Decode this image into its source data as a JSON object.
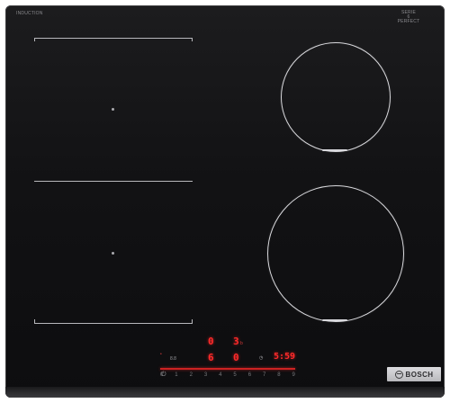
{
  "labels": {
    "induction": "INDUCTION",
    "serie_line1": "SERIE",
    "serie_line2": "6",
    "serie_line3": "PERFECT"
  },
  "display": {
    "zone_front_left_power": "0",
    "zone_front_left_setting": "6",
    "zone_rear_right_power": "3",
    "zone_rear_right_suffix": "b",
    "zone_front_right_setting": "0",
    "timer_value": "5:59",
    "timer_prefix": "8.8",
    "slider_digits": [
      "0",
      "1",
      "2",
      "3",
      "4",
      "5",
      "6",
      "7",
      "8",
      "9"
    ]
  },
  "brand": {
    "name": "BOSCH"
  },
  "colors": {
    "glass": "#121214",
    "zone_outline": "#d9d9dd",
    "display_red": "#ff2a2a"
  }
}
